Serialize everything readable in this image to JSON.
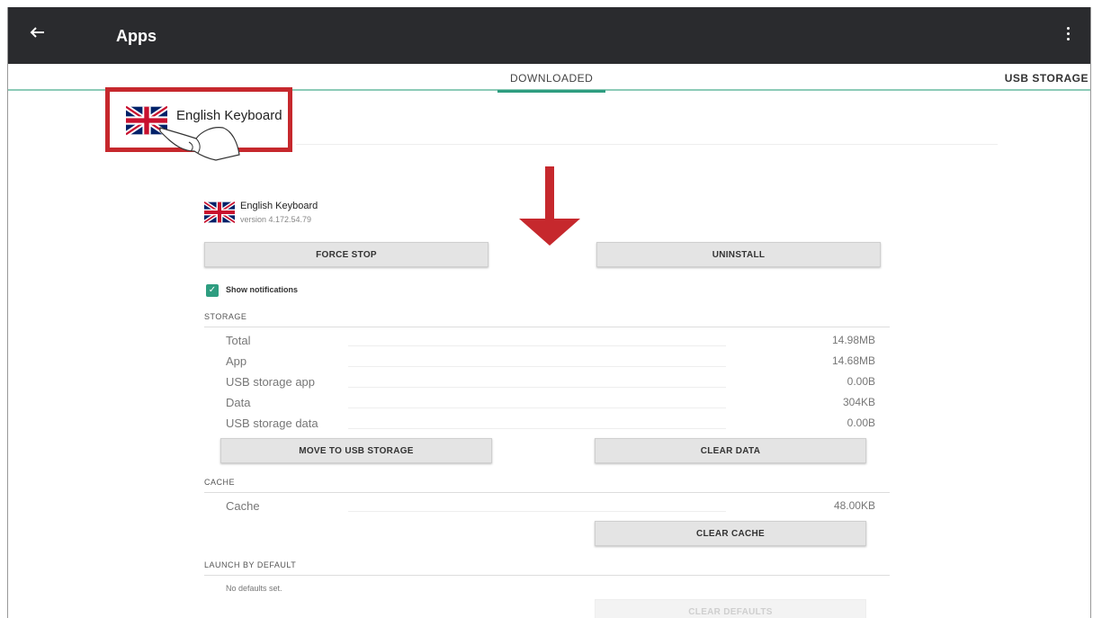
{
  "header": {
    "title": "Apps"
  },
  "tabs": {
    "downloaded": "DOWNLOADED",
    "usb_storage": "USB STORAGE"
  },
  "callout": {
    "app_name": "English Keyboard",
    "border_color": "#c6282d"
  },
  "app": {
    "name": "English Keyboard",
    "version": "version 4.172.54.79"
  },
  "buttons": {
    "force_stop": "FORCE STOP",
    "uninstall": "UNINSTALL",
    "move_to_usb": "MOVE TO USB STORAGE",
    "clear_data": "CLEAR DATA",
    "clear_cache": "CLEAR CACHE",
    "clear_defaults": "CLEAR DEFAULTS"
  },
  "notifications": {
    "label": "Show notifications",
    "checked": true
  },
  "storage": {
    "heading": "STORAGE",
    "rows": [
      {
        "label": "Total",
        "value": "14.98MB"
      },
      {
        "label": "App",
        "value": "14.68MB"
      },
      {
        "label": "USB storage app",
        "value": "0.00B"
      },
      {
        "label": "Data",
        "value": "304KB"
      },
      {
        "label": "USB storage data",
        "value": "0.00B"
      }
    ]
  },
  "cache": {
    "heading": "CACHE",
    "label": "Cache",
    "value": "48.00KB"
  },
  "launch": {
    "heading": "LAUNCH BY DEFAULT",
    "text": "No defaults set."
  },
  "colors": {
    "accent": "#2e9d80",
    "toolbar": "#2a2b2e",
    "arrow": "#c6282d"
  }
}
